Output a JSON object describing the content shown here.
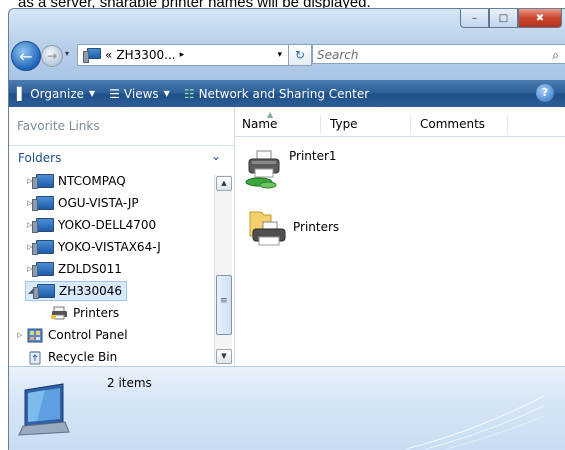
{
  "doc_text": "as a server, sharable printer names will be displayed.",
  "window": {
    "caption_buttons": {
      "minimize": "–",
      "maximize": "□",
      "close": "✖"
    },
    "address": {
      "crumb_prefix": "«",
      "crumb": "ZH3300...",
      "crumb_arrow": "▸",
      "dropdown": "▾",
      "refresh_glyph": "↻",
      "search_placeholder": "Search",
      "search_icon_glyph": "⌕"
    },
    "toolbar": {
      "organize": "Organize",
      "views": "Views",
      "network": "Network and Sharing Center",
      "help": "?"
    },
    "nav": {
      "favorite_links": "Favorite Links",
      "folders": "Folders",
      "folders_chevron": "⌄",
      "items": [
        {
          "label": "NTCOMPAQ",
          "icon": "computer-icon",
          "expand": "▷"
        },
        {
          "label": "OGU-VISTA-JP",
          "icon": "computer-icon",
          "expand": "▷"
        },
        {
          "label": "YOKO-DELL4700",
          "icon": "computer-icon",
          "expand": "▷"
        },
        {
          "label": "YOKO-VISTAX64-J",
          "icon": "computer-icon",
          "expand": "▷"
        },
        {
          "label": "ZDLDS011",
          "icon": "computer-icon",
          "expand": "▷"
        },
        {
          "label": "ZH330046",
          "icon": "computer-icon",
          "expand": "◢",
          "selected": true
        },
        {
          "label": "Printers",
          "icon": "printer-icon",
          "expand": ""
        },
        {
          "label": "Control Panel",
          "icon": "control-panel-icon",
          "expand": "▷"
        },
        {
          "label": "Recycle Bin",
          "icon": "recycle-bin-icon",
          "expand": ""
        }
      ]
    },
    "content": {
      "columns": [
        "Name",
        "Type",
        "Comments"
      ],
      "items": [
        {
          "label": "Printer1",
          "icon": "shared-printer-icon"
        },
        {
          "label": "Printers",
          "icon": "printer-folder-icon"
        }
      ]
    },
    "status": {
      "count_text": "2 items"
    },
    "colors": {
      "toolbar": "#2b5d97",
      "selection": "#d8eafc",
      "status_bg": "#d6e6f6"
    }
  }
}
